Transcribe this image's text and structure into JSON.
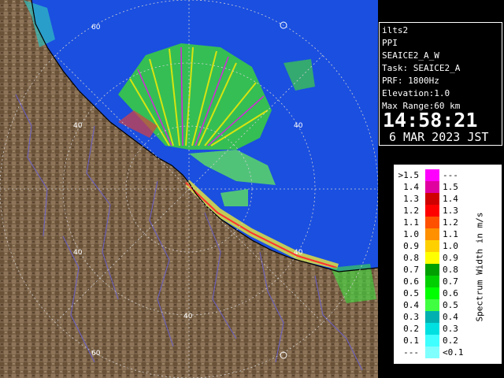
{
  "radar": {
    "site": "ilts2",
    "product": "PPI",
    "volume": "SEAICE2_A_W",
    "task": "Task: SEAICE2_A",
    "prf": "PRF: 1800Hz",
    "elevation": "Elevation:1.0",
    "max_range": "Max Range:60 km",
    "time": "14:58:21",
    "date": "6 MAR 2023 JST"
  },
  "map": {
    "ring_labels": [
      "60",
      "40",
      "40",
      "40",
      "40",
      "40",
      "60"
    ],
    "colors": {
      "sea": "#1a4fe0",
      "land": "#7a6248",
      "background": "#000000"
    }
  },
  "legend": {
    "title": "Spectrum Width in m/s",
    "rows": [
      {
        "left": ">1.5",
        "right": "---",
        "color": "#ff00ff"
      },
      {
        "left": "1.4",
        "right": "1.5",
        "color": "#e000a0"
      },
      {
        "left": "1.3",
        "right": "1.4",
        "color": "#d00000"
      },
      {
        "left": "1.2",
        "right": "1.3",
        "color": "#ff0000"
      },
      {
        "left": "1.1",
        "right": "1.2",
        "color": "#ff5000"
      },
      {
        "left": "1.0",
        "right": "1.1",
        "color": "#ff9000"
      },
      {
        "left": "0.9",
        "right": "1.0",
        "color": "#ffd000"
      },
      {
        "left": "0.8",
        "right": "0.9",
        "color": "#ffff00"
      },
      {
        "left": "0.7",
        "right": "0.8",
        "color": "#00a000"
      },
      {
        "left": "0.6",
        "right": "0.7",
        "color": "#00d000"
      },
      {
        "left": "0.5",
        "right": "0.6",
        "color": "#00ff00"
      },
      {
        "left": "0.4",
        "right": "0.5",
        "color": "#40ff40"
      },
      {
        "left": "0.3",
        "right": "0.4",
        "color": "#00b0b0"
      },
      {
        "left": "0.2",
        "right": "0.3",
        "color": "#00e0e0"
      },
      {
        "left": "0.1",
        "right": "0.2",
        "color": "#40ffff"
      },
      {
        "left": "---",
        "right": "<0.1",
        "color": "#80ffff"
      }
    ]
  }
}
